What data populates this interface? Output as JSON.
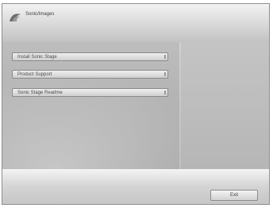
{
  "header": {
    "title": "Sonic/Images",
    "icon": "logo-icon"
  },
  "menu": {
    "items": [
      {
        "label": "Install Sonic Stage"
      },
      {
        "label": "Product Support"
      },
      {
        "label": "Sonic Stage Readme"
      }
    ]
  },
  "footer": {
    "exit_label": "Exit"
  },
  "colors": {
    "window_bg": "#b9b9b9",
    "header_bg": "#e6e6e6",
    "button_bg": "#e2e2e2",
    "text": "#444444"
  }
}
